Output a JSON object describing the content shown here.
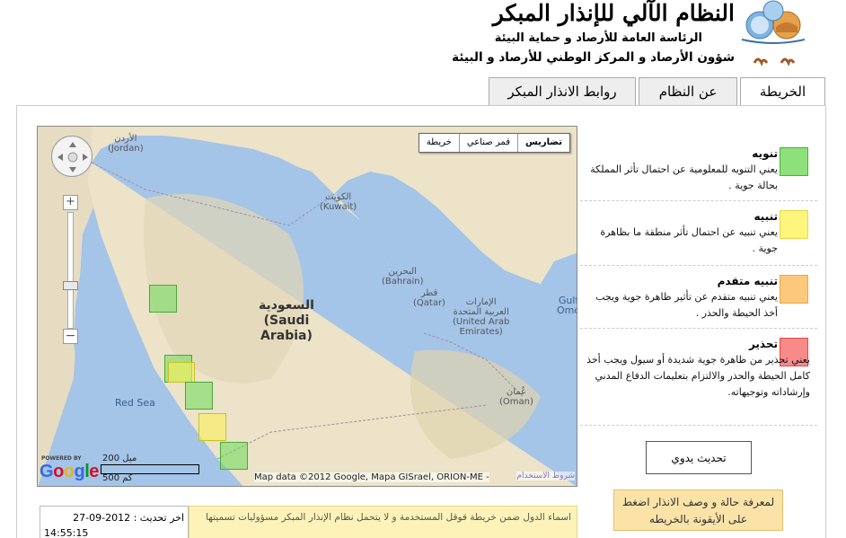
{
  "header": {
    "title": "النظام الآلي للإنذار المبكر",
    "subtitle_1": "الرئاسة العامة للأرصاد و حماية البيئة",
    "subtitle_2": "شؤون الأرصاد و المركز الوطني للأرصاد و البيئة"
  },
  "tabs": [
    {
      "label": "الخريطة",
      "active": true
    },
    {
      "label": "عن النظام",
      "active": false
    },
    {
      "label": "روابط الانذار المبكر",
      "active": false
    }
  ],
  "map": {
    "map_types": [
      {
        "label": "تضاريس",
        "active": true
      },
      {
        "label": "قمر صناعي",
        "active": false
      },
      {
        "label": "خريطة",
        "active": false
      }
    ],
    "labels": {
      "jordan_ar": "الأردن",
      "jordan_en": "(Jordan)",
      "kuwait_ar": "الكويت",
      "kuwait_en": "(Kuwait)",
      "saudi_ar": "السعودية",
      "saudi_en_1": "(Saudi",
      "saudi_en_2": "Arabia)",
      "bahrain_ar": "البحرين",
      "bahrain_en": "(Bahrain)",
      "qatar_ar": "قطر",
      "qatar_en": "(Qatar)",
      "uae_ar_1": "الإمارات",
      "uae_ar_2": "العربية المتحدة",
      "uae_en_1": "(United Arab",
      "uae_en_2": "Emirates)",
      "oman_ar": "عُمان",
      "oman_en": "(Oman)",
      "red_sea": "Red Sea",
      "gulf_1": "Gulf",
      "gulf_2": "Omo"
    },
    "zones": [
      {
        "level": "green"
      },
      {
        "level": "green"
      },
      {
        "level": "yellow"
      },
      {
        "level": "green"
      },
      {
        "level": "yellow"
      },
      {
        "level": "green"
      }
    ],
    "powered_by": "POWERED BY",
    "google": "Google",
    "scale_km": "200 ميل",
    "scale_mi": "500 كم",
    "attribution": "Map data ©2012 Google, Mapa GISrael, ORION-ME -",
    "terms": "شروط الاستخدام"
  },
  "legend": [
    {
      "title": "تنويه",
      "description": "يعني التنويه للمعلومية عن احتمال تأثر المملكة بحالة جوية .",
      "color": "#8ee07a",
      "border": "#49b03a"
    },
    {
      "title": "تنبيه",
      "description": "يعني تنبيه عن احتمال تأثر منطقة ما بظاهرة جوية .",
      "color": "#fdf57c",
      "border": "#e3d84a"
    },
    {
      "title": "تنبيه متقدم",
      "description": "يعني تنبيه متقدم عن تأثير ظاهرة جوية ويجب أخذ الحيطة والحذر .",
      "color": "#fcc97a",
      "border": "#e6a84a"
    },
    {
      "title": "تحذير",
      "description": "يعني تحذير من ظاهرة جوية شديدة أو سيول ويجب أخذ كامل الحيطة والحذر والالتزام بتعليمات الدفاع المدني وإرشاداته وتوجيهاته.",
      "color": "#f88a8a",
      "border": "#e04a4a"
    }
  ],
  "refresh_button": "تحديث يدوي",
  "info_box": "لمعرفة حالة و وصف الانذار اضغط على الأيقونة بالخريطه",
  "update": {
    "label": "اخر تحديث : 2012-09-27",
    "time": "14:55:15"
  },
  "disclaimer": "اسماء الدول ضمن خريطة قوقل المستخدمة و لا يتحمل نظام الإنذار المبكر مسؤوليات تسميتها"
}
